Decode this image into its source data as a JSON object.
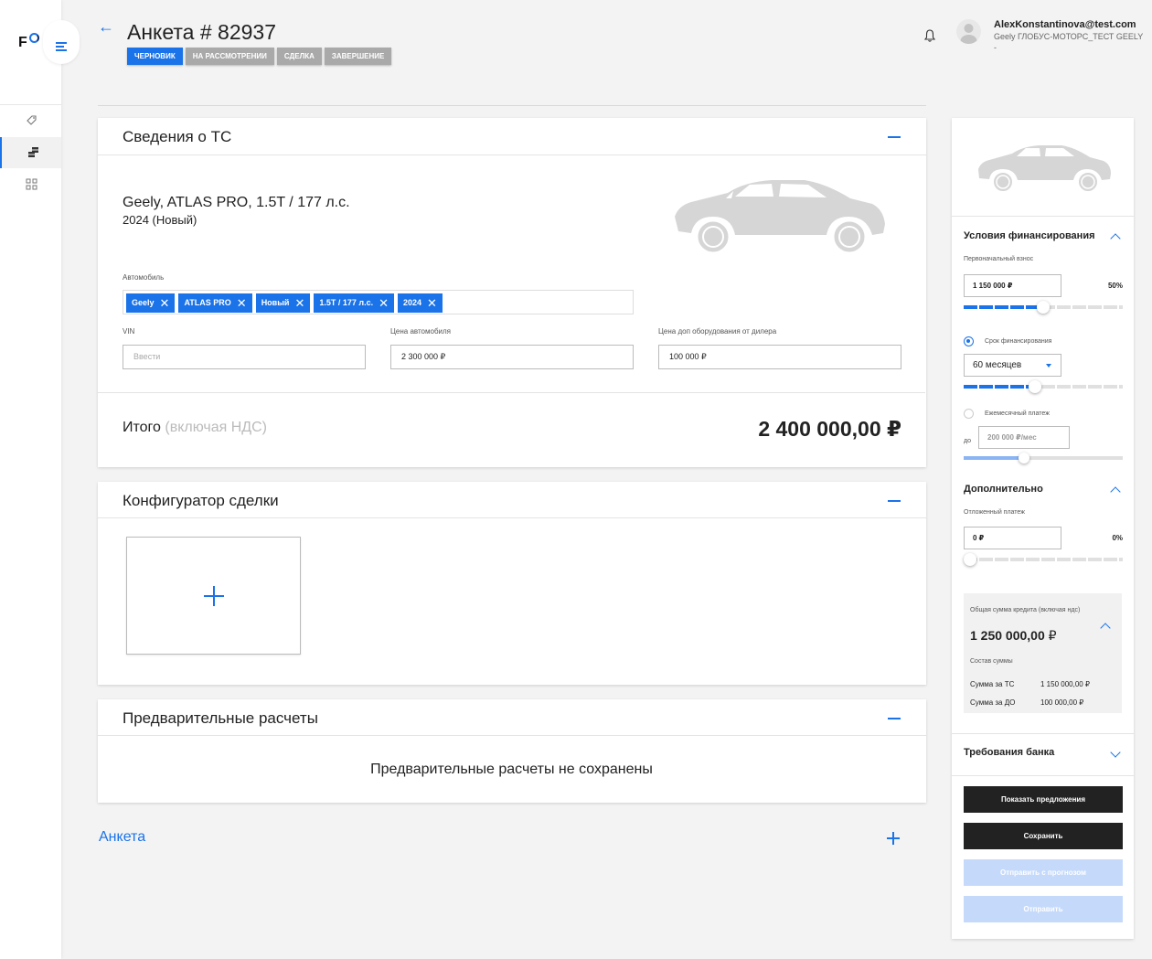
{
  "header": {
    "title": "Анкета # 82937",
    "stages": [
      "ЧЕРНОВИК",
      "НА РАССМОТРЕНИИ",
      "СДЕЛКА",
      "ЗАВЕРШЕНИЕ"
    ],
    "user_email": "AlexKonstantinova@test.com",
    "user_org": "Geely ГЛОБУС-МОТОРС_ТЕСТ GEELY",
    "user_extra": "-"
  },
  "vehicle": {
    "title": "Сведения о ТС",
    "car_name": "Geely, ATLAS PRO, 1.5T / 177 л.с.",
    "car_year": "2024 (Новый)",
    "auto_label": "Автомобиль",
    "chips": [
      "Geely",
      "ATLAS PRO",
      "Новый",
      "1.5T / 177 л.с.",
      "2024"
    ],
    "vin_label": "VIN",
    "vin_placeholder": "Ввести",
    "price_label": "Цена автомобиля",
    "price_value": "2 300 000 ₽",
    "extra_label": "Цена доп оборудования от дилера",
    "extra_value": "100 000 ₽",
    "total_label": "Итого",
    "total_muted": "(включая НДС)",
    "total_value": "2 400 000,00 ₽"
  },
  "configurator": {
    "title": "Конфигуратор сделки"
  },
  "calculations": {
    "title": "Предварительные расчеты",
    "empty": "Предварительные расчеты не сохранены"
  },
  "anketa": {
    "label": "Анкета"
  },
  "panel": {
    "financing_title": "Условия финансирования",
    "down_label": "Первоначальный взнос",
    "down_value": "1 150 000 ₽",
    "down_pct": "50%",
    "down_fraction": 0.5,
    "term_label": "Срок финансирования",
    "term_value": "60 месяцев",
    "term_fraction": 0.45,
    "monthly_label": "Ежемесячный платеж",
    "monthly_prefix": "до",
    "monthly_placeholder": "200 000 ₽/мес",
    "monthly_fraction": 0.38,
    "extra_title": "Дополнительно",
    "deferred_label": "Отложенный платеж",
    "deferred_value": "0 ₽",
    "deferred_pct": "0%",
    "deferred_fraction": 0,
    "sum_label": "Общая сумма кредита (включая ндс)",
    "sum_value": "1 250 000,00",
    "sum_currency": "₽",
    "composition_label": "Состав суммы",
    "rows": [
      {
        "label": "Сумма за ТС",
        "value": "1 150 000,00 ₽"
      },
      {
        "label": "Сумма за ДО",
        "value": "100 000,00 ₽"
      }
    ],
    "bank_title": "Требования банка",
    "btn_show": "Показать предложения",
    "btn_save": "Сохранить",
    "btn_send_forecast": "Отправить с прогнозом",
    "btn_send": "Отправить"
  }
}
